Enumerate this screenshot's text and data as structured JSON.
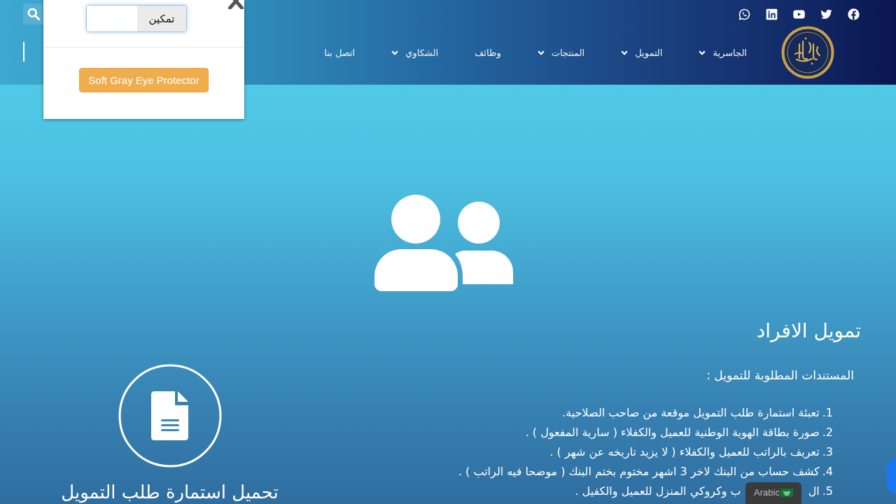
{
  "popup": {
    "toggle": {
      "label": "تمكين",
      "on": false
    },
    "button": "Soft Gray Eye Protector"
  },
  "header": {
    "nav": [
      {
        "label": "الجاسرية",
        "dropdown": true
      },
      {
        "label": "التمويل",
        "dropdown": true
      },
      {
        "label": "المنتجات",
        "dropdown": true
      },
      {
        "label": "وظائف",
        "dropdown": false
      },
      {
        "label": "الشكاوي",
        "dropdown": true
      },
      {
        "label": "اتصل بنا",
        "dropdown": false
      }
    ]
  },
  "main": {
    "heading": "تمويل الافراد",
    "subheading": "المستندات المطلوبة للتمويل :",
    "documents": [
      {
        "number": "1.",
        "parts": [
          "تعبئة استمارة طلب التمويل موقعة من صاحب الصلاحية."
        ]
      },
      {
        "number": "2.",
        "parts": [
          "صورة بطاقة الهوية الوطنية للعميل والكفلاء ( سارية المفعول ) ."
        ]
      },
      {
        "number": "3.",
        "parts": [
          "تعريف بالراتب للعميل والكفلاء ( لا يزيد تاريخه عن شهر ) ."
        ]
      },
      {
        "number": "4.",
        "parts": [
          "كشف حساب من البنك لاخر 3 اشهر مختوم بختم البنك ( موضحا فيه الراتب ) ."
        ]
      },
      {
        "number": "5.",
        "parts": [
          "ال",
          "ب وكروكي المنزل للعميل والكفيل ."
        ]
      }
    ]
  },
  "download": {
    "title": "تحميل استمارة طلب التمويل"
  },
  "language_widget": {
    "label": "Arabic"
  }
}
